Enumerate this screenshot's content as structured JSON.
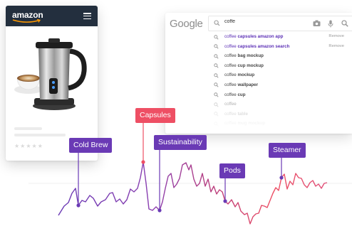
{
  "amazon": {
    "brand": "amazon",
    "icons": {
      "menu": "hamburger-menu-icon",
      "product": "milk-frother-product-image",
      "rating": "star-rating-icons"
    },
    "rating_stars": "★★★★★",
    "colors": {
      "header": "#232f3e",
      "smile": "#ff9900"
    }
  },
  "google": {
    "brand": "Google",
    "query": "coffe",
    "icons": {
      "search": "magnifier-icon",
      "camera": "camera-icon",
      "mic": "microphone-icon"
    },
    "suggestions": [
      {
        "prefix": "coffee ",
        "suffix": "capsules amazon app",
        "action": "Remove",
        "history": true
      },
      {
        "prefix": "coffee ",
        "suffix": "capsules amazon search",
        "action": "Remove",
        "history": true
      },
      {
        "prefix": "coffee ",
        "suffix": "bag mockup",
        "action": "",
        "history": false
      },
      {
        "prefix": "coffee ",
        "suffix": "cup mockup",
        "action": "",
        "history": false
      },
      {
        "prefix": "coffee ",
        "suffix": "mockup",
        "action": "",
        "history": false
      },
      {
        "prefix": "coffee ",
        "suffix": "wallpaper",
        "action": "",
        "history": false
      },
      {
        "prefix": "coffee ",
        "suffix": "cup",
        "action": "",
        "history": false
      },
      {
        "prefix": "coffee",
        "suffix": "",
        "action": "",
        "history": false
      },
      {
        "prefix": "coffee ",
        "suffix": "table",
        "action": "",
        "history": false
      },
      {
        "prefix": "coffee ",
        "suffix": "mug mockup",
        "action": "",
        "history": false
      }
    ]
  },
  "trend": {
    "labels": {
      "cold_brew": "Cold Brew",
      "capsules": "Capsules",
      "sustainability": "Sustainability",
      "pods": "Pods",
      "steamer": "Steamer"
    },
    "colors": {
      "purple": "#6a3ab5",
      "red": "#ee4f64"
    }
  }
}
